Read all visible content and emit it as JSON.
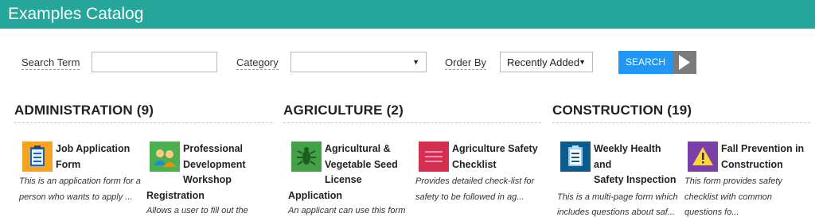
{
  "app": {
    "title": "Examples Catalog"
  },
  "filters": {
    "search_term_label": "Search Term",
    "search_term_value": "",
    "category_label": "Category",
    "category_value": "",
    "order_by_label": "Order By",
    "order_by_value": "Recently Added",
    "search_button_label": "SEARCH"
  },
  "colors": {
    "header": "#26a69a",
    "search_button": "#2196f3",
    "search_arrow": "#7b7b7b"
  },
  "categories": [
    {
      "heading": "ADMINISTRATION (9)",
      "items": [
        {
          "name_lines": [
            "Job Application",
            "Form"
          ],
          "description": "This is an application form for a person who wants to apply ...",
          "icon": "clipboard-form-icon",
          "icon_color": "#f4a322"
        },
        {
          "name_lines": [
            "Professional",
            "Development",
            "Workshop",
            "Registration"
          ],
          "description": "Allows a user to fill out the",
          "icon": "people-icon",
          "icon_color": "#4caf50"
        }
      ]
    },
    {
      "heading": "AGRICULTURE (2)",
      "items": [
        {
          "name_lines": [
            "Agricultural &",
            "Vegetable Seed",
            "License",
            "Application"
          ],
          "description": "An applicant can use this form",
          "icon": "bug-icon",
          "icon_color": "#43a047"
        },
        {
          "name_lines": [
            "Agriculture Safety",
            "Checklist"
          ],
          "description": "Provides detailed check-list for safety to be followed in ag...",
          "icon": "list-icon",
          "icon_color": "#d32f4f"
        }
      ]
    },
    {
      "heading": "CONSTRUCTION (19)",
      "items": [
        {
          "name_lines": [
            "Weekly Health and",
            "Safety Inspection"
          ],
          "description": "This is a multi-page form which includes questions about saf...",
          "icon": "clipboard-form-icon",
          "icon_color": "#0d5a8c"
        },
        {
          "name_lines": [
            "Fall Prevention in",
            "Construction"
          ],
          "description": "This form provides safety checklist with common questions fo...",
          "icon": "warning-icon",
          "icon_color": "#7b3fa8"
        }
      ]
    }
  ]
}
